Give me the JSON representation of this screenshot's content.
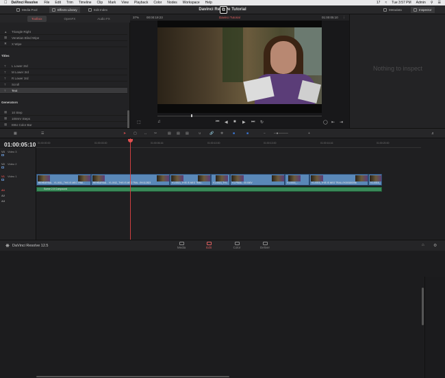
{
  "menubar": {
    "app": "DaVinci Resolve",
    "items": [
      "File",
      "Edit",
      "Trim",
      "Timeline",
      "Clip",
      "Mark",
      "View",
      "Playback",
      "Color",
      "Nodes",
      "Workspace",
      "Help"
    ],
    "clock": "Tue 3:57 PM",
    "user": "Admin",
    "battery": "17"
  },
  "topbar": {
    "media_pool": "Media Pool",
    "effects_library": "Effects Library",
    "edit_index": "Edit Index",
    "project_title": "Davinci Resolve Tutorial",
    "metadata": "Metadata",
    "inspector": "Inspector"
  },
  "library": {
    "tabs": [
      "Toolbox",
      "OpenFX",
      "Audio FX"
    ],
    "transitions": [
      "Triangle Right",
      "Venetian Blind Wipe",
      "X Wipe"
    ],
    "titles_header": "Titles",
    "titles": [
      "L Lower 3rd",
      "M Lower 3rd",
      "R Lower 3rd",
      "Scroll",
      "Text"
    ],
    "generators_header": "Generators",
    "generators": [
      "10 Step",
      "100mV Steps",
      "EBU Color Bar"
    ]
  },
  "viewer": {
    "zoom": "37%",
    "source_tc": "00:00:19:23",
    "timeline_name": "Davinci Tutorial",
    "record_tc": "01:00:05:10"
  },
  "inspector": {
    "empty_message": "Nothing to inspect"
  },
  "timeline": {
    "timecode": "01:00:05:10",
    "ruler": [
      "01:00:00:00",
      "01:00:03:00",
      "01:00:06:16",
      "01:00:10:00",
      "01:00:13:00",
      "01:00:16:16",
      "01:00:20:00"
    ],
    "tracks": [
      {
        "id": "V3",
        "name": "Video 3"
      },
      {
        "id": "V2",
        "name": "Video 2"
      },
      {
        "id": "V1",
        "name": "Video 1"
      },
      {
        "id": "A1",
        "name": ""
      },
      {
        "id": "A2",
        "name": ""
      },
      {
        "id": "A3",
        "name": ""
      }
    ],
    "clips": [
      "REHEARSAL - V1-0011_THIS IS MEG TRAI...",
      "REHEARSAL - V1-0012_THIS IS MEG TRAI...EKI112823",
      "V1-0013_THIS IS MEG TRAI...",
      "V1-0013_THI...",
      "V1-FINAL - 00:000V",
      "V1-0016_...",
      "V1-0015_THIS IS MEG TRAIL-EKI00180098",
      "V1-0015_"
    ],
    "audio_clip": "Scene 2-5 Compound"
  },
  "pagebar": {
    "app_name": "DaVinci Resolve 12.5",
    "pages": [
      "Media",
      "Edit",
      "Color",
      "Deliver"
    ]
  }
}
